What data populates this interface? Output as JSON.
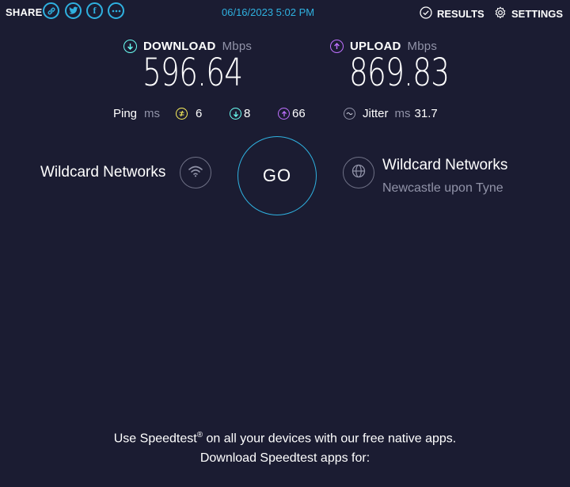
{
  "header": {
    "share_label": "SHARE",
    "share_icons": [
      "link-icon",
      "twitter-icon",
      "facebook-icon",
      "more-icon"
    ],
    "timestamp": "06/16/2023 5:02 PM",
    "results_label": "RESULTS",
    "settings_label": "SETTINGS"
  },
  "download": {
    "label": "DOWNLOAD",
    "unit": "Mbps",
    "value": "596.64",
    "color": "#6afff3"
  },
  "upload": {
    "label": "UPLOAD",
    "unit": "Mbps",
    "value": "869.83",
    "color": "#bf71ff"
  },
  "ping": {
    "label": "Ping",
    "unit": "ms",
    "idle": "6",
    "download": "8",
    "upload": "66"
  },
  "jitter": {
    "label": "Jitter",
    "unit": "ms",
    "value": "31.7"
  },
  "go_label": "GO",
  "isp": {
    "name": "Wildcard Networks"
  },
  "server": {
    "name": "Wildcard Networks",
    "location": "Newcastle upon Tyne"
  },
  "footer": {
    "line1_prefix": "Use Speedtest",
    "line1_reg": "®",
    "line1_suffix": " on all your devices with our free native apps.",
    "line2": "Download Speedtest apps for:"
  },
  "colors": {
    "background": "#1b1c32",
    "accent": "#2fb1e0",
    "ping_idle": "#fbf05c"
  }
}
